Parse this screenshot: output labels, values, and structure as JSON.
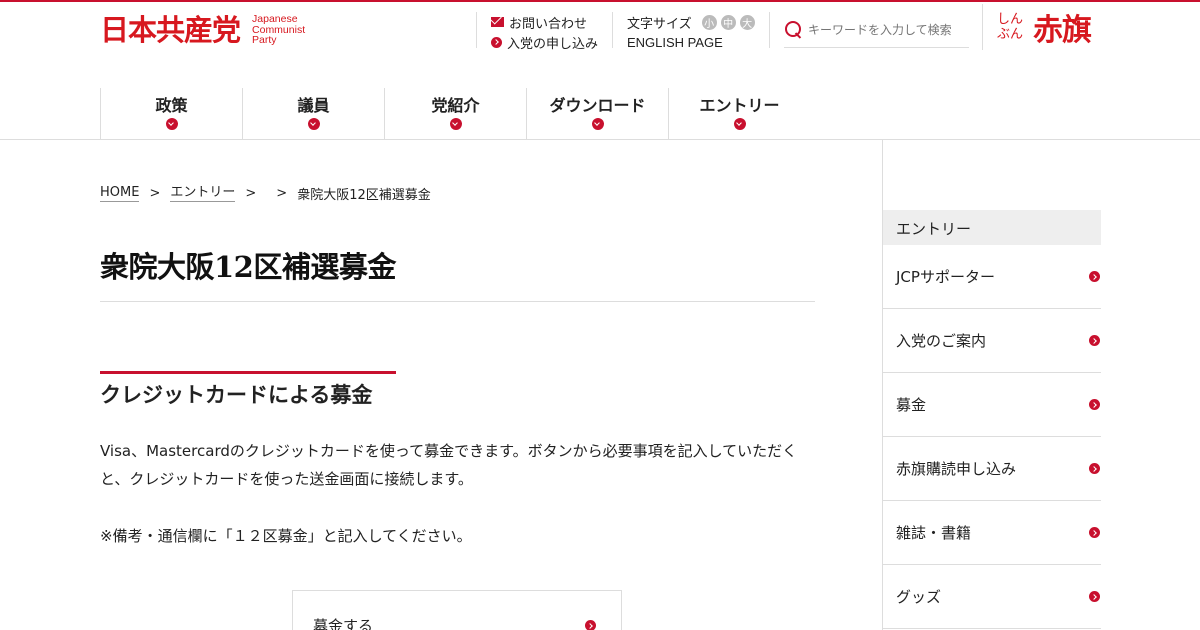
{
  "header": {
    "logo_jp": "日本共産党",
    "logo_en": [
      "Japanese",
      "Communist",
      "Party"
    ],
    "contact_label": "お問い合わせ",
    "join_label": "入党の申し込み",
    "font_size_label": "文字サイズ",
    "font_sizes": [
      "小",
      "中",
      "大"
    ],
    "english_label": "ENGLISH PAGE",
    "search_placeholder": "キーワードを入力して検索",
    "akahata_small": "しんぶん",
    "akahata_big": "赤旗"
  },
  "nav": {
    "items": [
      "政策",
      "議員",
      "党紹介",
      "ダウンロード",
      "エントリー"
    ]
  },
  "breadcrumb": {
    "home": "HOME",
    "sep": ">",
    "entry": "エントリー",
    "current": "衆院大阪12区補選募金"
  },
  "main": {
    "title": "衆院大阪12区補選募金",
    "section_heading": "クレジットカードによる募金",
    "body": "Visa、Mastercardのクレジットカードを使って募金できます。ボタンから必要事項を記入していただくと、クレジットカードを使った送金画面に接続します。",
    "note": "※備考・通信欄に「１２区募金」と記入してください。",
    "donate_button": "募金する"
  },
  "sidebar": {
    "heading": "エントリー",
    "items": [
      "JCPサポーター",
      "入党のご案内",
      "募金",
      "赤旗購読申し込み",
      "雑誌・書籍",
      "グッズ"
    ]
  },
  "colors": {
    "accent": "#c8102e",
    "logo_red": "#d7181f",
    "rule": "#dddddd"
  }
}
